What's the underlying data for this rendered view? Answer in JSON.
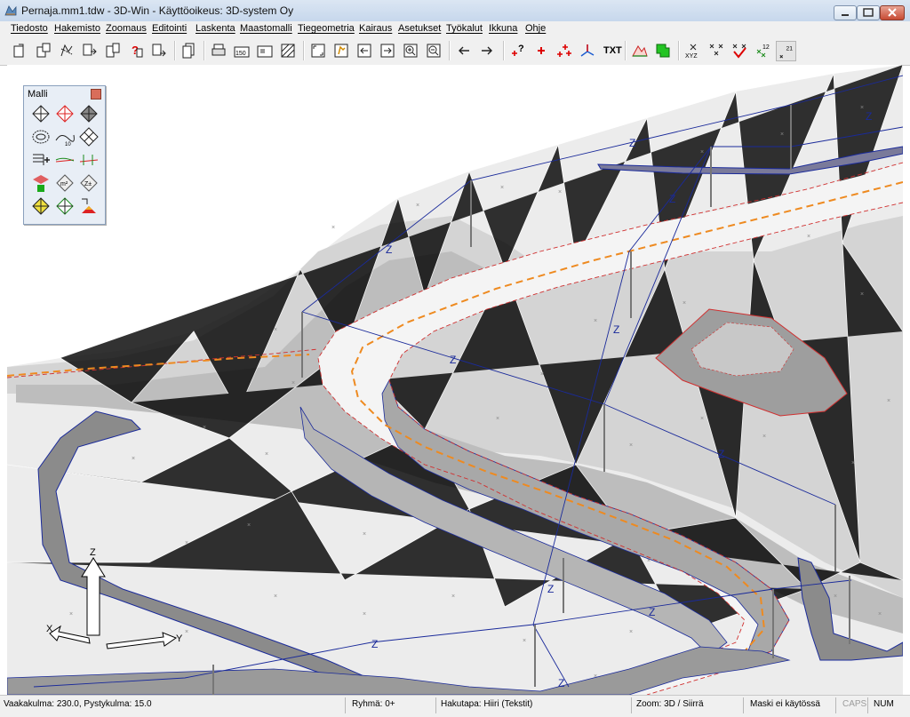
{
  "window": {
    "title": "Pernaja.mm1.tdw - 3D-Win - Käyttöoikeus: 3D-system Oy"
  },
  "menu": [
    "Tiedosto",
    "Hakemisto",
    "Zoomaus",
    "Editointi",
    "Laskenta",
    "Maastomalli",
    "Tiegeometria",
    "Kairaus",
    "Asetukset",
    "Työkalut",
    "Ikkuna",
    "Ohje"
  ],
  "toolbar": {
    "text_button": "TXT",
    "icons": [
      "open-icon",
      "save-icon",
      "save-as-icon",
      "export-icon",
      "import-icon",
      "help-query-icon",
      "close-file-icon",
      "copy-icon",
      "print-icon",
      "scale-icon",
      "page-icon",
      "hatch-icon",
      "zoom-extents-icon",
      "pan-icon",
      "zoom-prev-icon",
      "zoom-next-icon",
      "zoom-in-icon",
      "zoom-out-icon",
      "arrow-left-icon",
      "arrow-right-icon",
      "point-query-icon",
      "add-point-icon",
      "multi-point-icon",
      "axis-icon",
      "text-icon",
      "terrain-icon",
      "label-icon",
      "point-xyz-icon",
      "grid-points-icon",
      "check-points-icon",
      "height-points-icon",
      "corner-icon"
    ]
  },
  "palette": {
    "title": "Malli",
    "icons": [
      "tin-model-icon",
      "tin-red-icon",
      "tin-shaded-icon",
      "contour-icon",
      "contour-interval-icon",
      "grid-model-icon",
      "breakline-icon",
      "profile-icon",
      "cross-section-icon",
      "volume-icon",
      "area-m2-icon",
      "height-z-icon",
      "tin-yellow-icon",
      "tin-green-icon",
      "tin-color-icon"
    ]
  },
  "viewport": {
    "axis_labels": {
      "z": "Z",
      "x": "X",
      "y": "Y"
    },
    "z_marks": "Z"
  },
  "status": {
    "angles": "Vaakakulma: 230.0, Pystykulma: 15.0",
    "group": "Ryhmä: 0+",
    "search_mode": "Hakutapa: Hiiri (Tekstit)",
    "zoom": "Zoom: 3D  /  Siirrä",
    "mask": "Maski ei käytössä",
    "caps": "CAPS",
    "num": "NUM"
  }
}
